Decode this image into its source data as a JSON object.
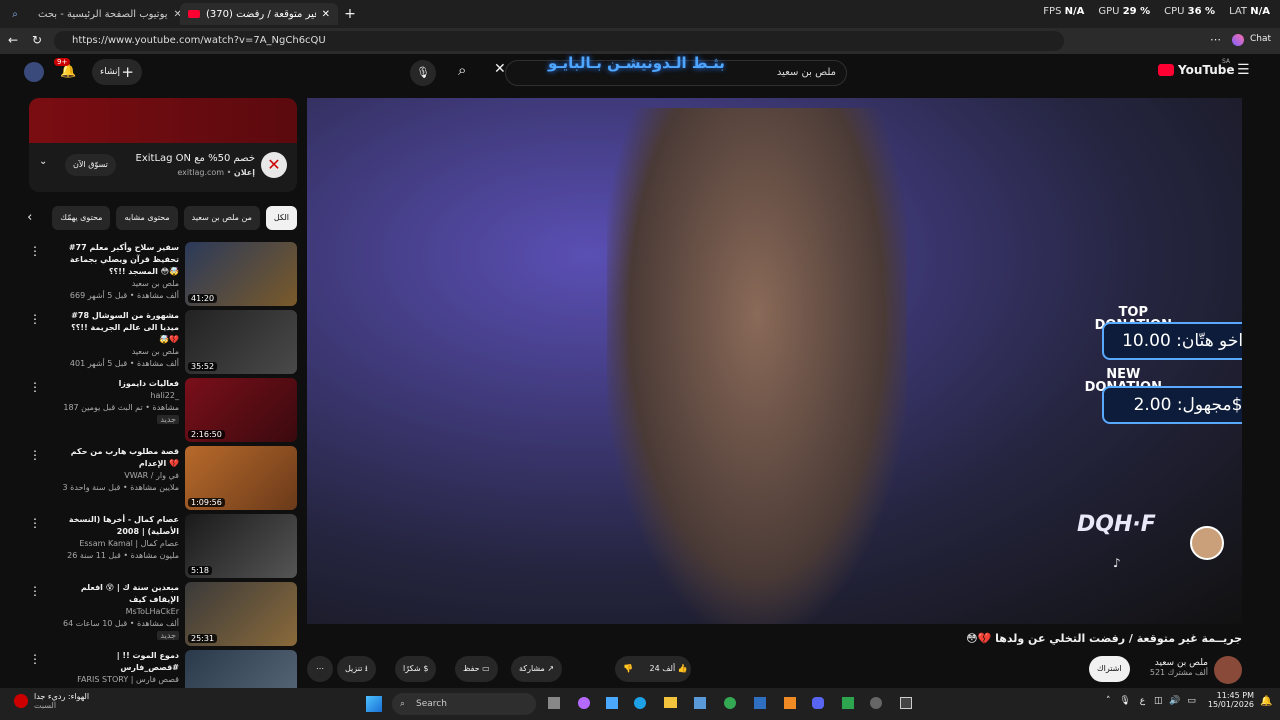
{
  "browser": {
    "tabs": [
      {
        "label": "يوتيوب الصفحة الرئيسية - بحث"
      },
      {
        "label": "(370) جريــمة غير متوقعة / رفضت"
      }
    ],
    "stats": [
      {
        "name": "FPS",
        "value": "N/A"
      },
      {
        "name": "GPU",
        "value": "29 %"
      },
      {
        "name": "CPU",
        "value": "36 %"
      },
      {
        "name": "LAT",
        "value": "N/A"
      }
    ],
    "url": "https://www.youtube.com/watch?v=7A_NgCh6cQU",
    "chat_label": "Chat"
  },
  "youtube": {
    "logo_text": "YouTube",
    "region": "SA",
    "search_value": "ملص بن سعيد",
    "overlay_banner": "بثـط الـدونيشـن بـالبايـو",
    "create_label": "إنشاء",
    "notif_count": "9+"
  },
  "promo": {
    "title": "خصم 50% مع ExitLag ON",
    "ad_label": "إعلان",
    "domain": "exitlag.com",
    "cta": "تسوّق الآن"
  },
  "chips": [
    {
      "label": "الكل",
      "active": true
    },
    {
      "label": "من ملص بن سعيد"
    },
    {
      "label": "محتوى مشابه"
    },
    {
      "label": "محتوى يهمّك"
    }
  ],
  "recommendations": [
    {
      "title": "#77 سفير سلاح وأكبر معلم تحفيظ قرآن ويصلي بجماعة المسجد !!؟؟ 😳🤯",
      "channel": "ملص بن سعيد",
      "meta": "669 ألف مشاهدة • قبل 5 أشهر",
      "duration": "41:20"
    },
    {
      "title": "#78 مشهورة من السوشال ميديا الى عالم الجريمة !!؟؟ 🤯💔",
      "channel": "ملص بن سعيد",
      "meta": "401 ألف مشاهدة • قبل 5 أشهر",
      "duration": "35:52"
    },
    {
      "title": "فعاليات دايموزا",
      "channel": "hali22_",
      "meta": "187 مشاهدة • تم البث قبل يومين",
      "badge": "جديد",
      "duration": "2:16:50"
    },
    {
      "title": "قصة مطلوب هارب من حكم الإعدام 💔",
      "channel": "VWAR / في وار",
      "meta": "3 ملايين مشاهدة • قبل سنة واحدة",
      "duration": "1:09:56"
    },
    {
      "title": "عصام كمال - أخرها (النسخة الأصلية) | 2008",
      "channel": "Essam Kamal | عصام كمال",
      "meta": "26 مليون مشاهدة • قبل 11 سنة",
      "duration": "5:18"
    },
    {
      "title": "مبعدين سنة ك | 😵 افعلم الإيقاف كيف",
      "channel": "MsToLHaCkEr",
      "meta": "64 ألف مشاهدة • قبل 10 ساعات",
      "badge": "جديد",
      "duration": "25:31"
    },
    {
      "title": "دموع الموت !! | #قصص_فارس",
      "channel": "FARIS STORY | قصص فارس",
      "meta": "",
      "duration": ""
    }
  ],
  "video": {
    "top_donation_label": "TOP\nDONATION",
    "top_donation": "اخو هتّان: 10.00$",
    "new_donation_label": "NEW\nDONATION",
    "new_donation": "مجهول: 2.00$",
    "watermark": "DQH·F",
    "title": "جريــمة غير متوقعة / رفضت التخلي عن ولدها 💔😳",
    "channel": "ملص بن سعيد",
    "subscribers": "521 ألف مشترك",
    "subscribe_label": "اشتراك",
    "likes": "24 ألف",
    "share_label": "مشاركة",
    "save_label": "حفظ",
    "thanks_label": "شكرًا",
    "download_label": "تنزيل"
  },
  "taskbar": {
    "weather": "الهواء: رديء جدا",
    "weather_sub": "السبت",
    "search_placeholder": "Search",
    "lang": "ع",
    "time": "11:45 PM",
    "date": "15/01/2026"
  }
}
